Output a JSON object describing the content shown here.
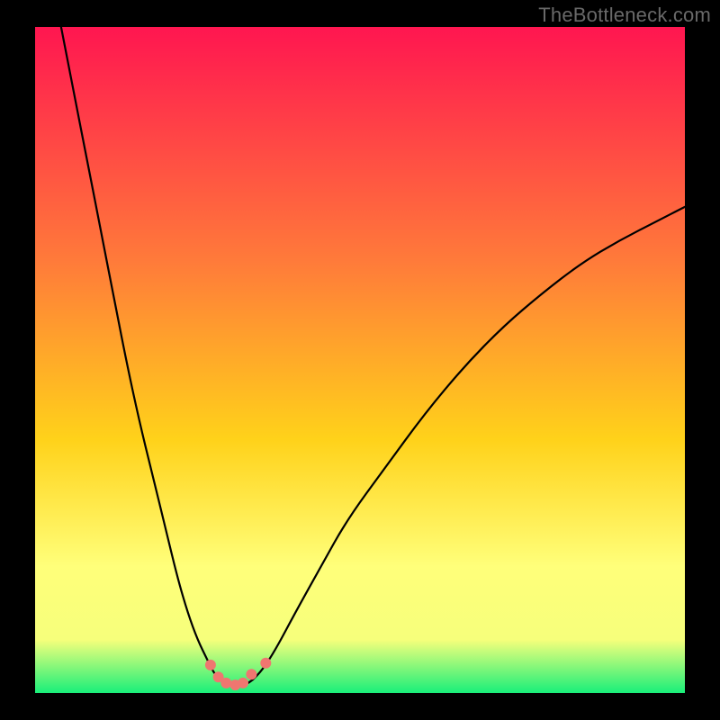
{
  "watermark": "TheBottleneck.com",
  "colors": {
    "black": "#000000",
    "curve": "#000000",
    "marker": "#ef7670",
    "watermark": "#696969",
    "grad_top": "#ff1650",
    "grad_mid1": "#ff7a3a",
    "grad_mid2": "#ffd21a",
    "grad_mid3": "#ffff7a",
    "grad_mid4": "#f6ff7b",
    "grad_bot": "#19ef7a"
  },
  "chart_data": {
    "type": "line",
    "title": "",
    "xlabel": "",
    "ylabel": "",
    "xlim": [
      0,
      100
    ],
    "ylim": [
      0,
      100
    ],
    "grid": false,
    "legend": false,
    "series": [
      {
        "name": "curve-left",
        "x": [
          4,
          6,
          8,
          10,
          12,
          14,
          16,
          18,
          20,
          22,
          23.5,
          25,
          26.5,
          27.5,
          28.5
        ],
        "y": [
          100,
          90,
          80,
          70,
          60,
          50,
          41,
          33,
          25,
          17,
          12,
          8,
          5,
          3,
          2
        ]
      },
      {
        "name": "valley-floor",
        "x": [
          28.5,
          29.5,
          30.5,
          31.5,
          32.5,
          33.5
        ],
        "y": [
          2,
          1.3,
          1.1,
          1.1,
          1.3,
          2
        ]
      },
      {
        "name": "curve-right",
        "x": [
          33.5,
          35,
          37,
          40,
          44,
          48,
          54,
          60,
          66,
          72,
          78,
          84,
          90,
          96,
          100
        ],
        "y": [
          2,
          3.5,
          6.5,
          12,
          19,
          26,
          34,
          42,
          49,
          55,
          60,
          64.5,
          68,
          71,
          73
        ]
      }
    ],
    "markers": {
      "name": "valley-markers",
      "points": [
        {
          "x": 27.0,
          "y": 4.2
        },
        {
          "x": 28.2,
          "y": 2.4
        },
        {
          "x": 29.4,
          "y": 1.5
        },
        {
          "x": 30.8,
          "y": 1.2
        },
        {
          "x": 32.0,
          "y": 1.5
        },
        {
          "x": 33.3,
          "y": 2.8
        },
        {
          "x": 35.5,
          "y": 4.5
        }
      ]
    }
  }
}
